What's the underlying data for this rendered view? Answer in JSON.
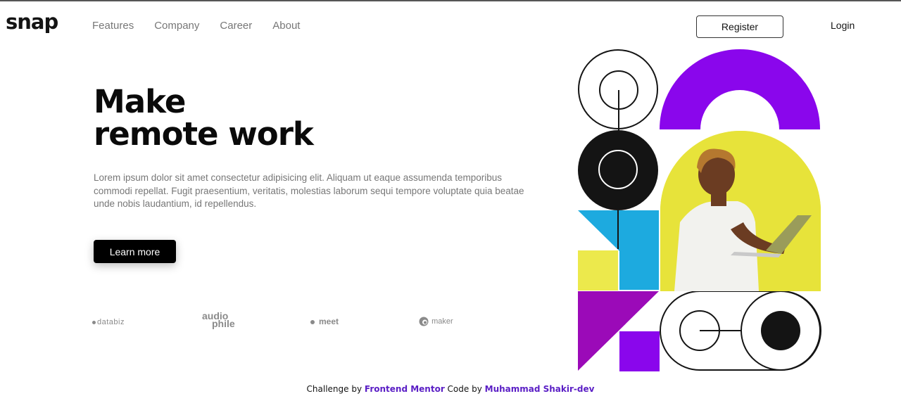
{
  "brand": {
    "logo": "snap"
  },
  "nav": {
    "items": [
      "Features",
      "Company",
      "Career",
      "About"
    ]
  },
  "auth": {
    "register_label": "Register",
    "login_label": "Login"
  },
  "hero": {
    "title_line1": "Make",
    "title_line2": "remote work",
    "text": "Lorem ipsum dolor sit amet consectetur adipisicing elit. Aliquam ut eaque assumenda temporibus commodi repellat. Fugit praesentium, veritatis, molestias laborum sequi tempore voluptate quia beatae unde nobis laudantium, id repellendus.",
    "cta_label": "Learn more"
  },
  "clients": {
    "databiz": "databiz",
    "audio_top": "audio",
    "audio_bottom": "phile",
    "meet": "meet",
    "maker": "maker"
  },
  "footer": {
    "prefix": "Challenge by ",
    "challenge_link": "Frontend Mentor",
    "middle": " Code by ",
    "author_link": "Muhammad Shakir-dev"
  },
  "colors": {
    "purple": "#8a06ec",
    "yellow": "#ece94c",
    "blue": "#1daadf",
    "magenta": "#9b0ab8",
    "black": "#141414",
    "accent": "#5a1ec5"
  },
  "icons": {
    "maker": "maker-logo-icon",
    "meet": "meet-dots-icon",
    "databiz": "databiz-dot-icon"
  }
}
